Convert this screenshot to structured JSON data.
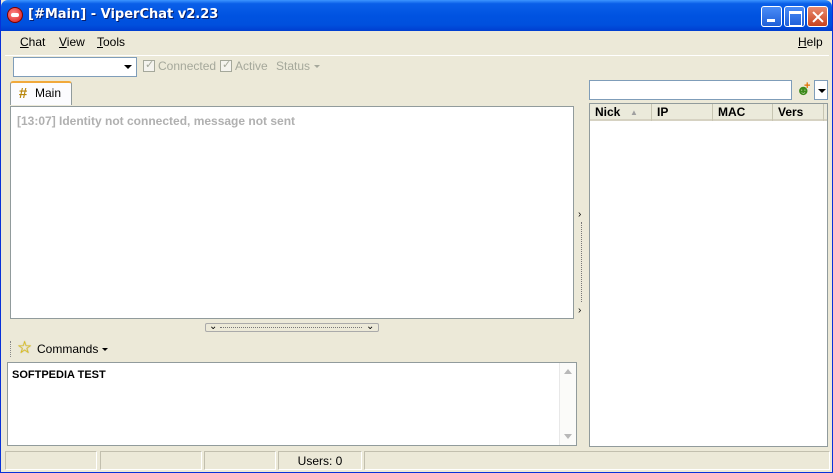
{
  "window": {
    "title": "[#Main] - ViperChat v2.23"
  },
  "menu": {
    "chat_letter": "C",
    "chat_rest": "hat",
    "view_letter": "V",
    "view_rest": "iew",
    "tools_letter": "T",
    "tools_rest": "ools",
    "help_letter": "H",
    "help_rest": "elp"
  },
  "toolbar": {
    "identity_value": "",
    "connected_label": "Connected",
    "connected_checked": true,
    "active_label": "Active",
    "active_checked": true,
    "status_label": "Status"
  },
  "tabs": [
    {
      "label": "Main",
      "icon": "hash-icon",
      "selected": true
    }
  ],
  "chat": {
    "lines": [
      "[13:07] Identity not connected, message not sent"
    ]
  },
  "commands": {
    "label": "Commands",
    "icon": "star-icon"
  },
  "input": {
    "value": "SOFTPEDIA TEST"
  },
  "userlist": {
    "search_value": "",
    "columns": [
      "Nick",
      "IP",
      "MAC",
      "Vers"
    ],
    "rows": []
  },
  "statusbar": {
    "panes": [
      "",
      "",
      "",
      "Users: 0",
      ""
    ]
  },
  "colors": {
    "titlebar": "#0053e1",
    "window_bg": "#ece9d8",
    "tab_accent": "#f1a93b"
  }
}
